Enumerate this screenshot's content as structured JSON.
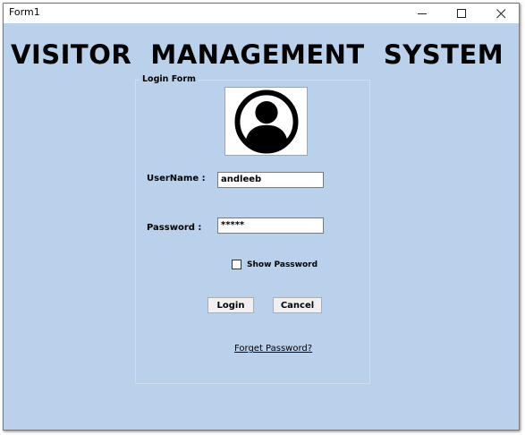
{
  "window": {
    "title": "Form1",
    "minimize_label": "—",
    "maximize_label": "☐",
    "close_label": "✕"
  },
  "app": {
    "title": "VISITOR  MANAGEMENT  SYSTEM"
  },
  "login_form": {
    "group_label": "Login Form",
    "username_label": "UserName :",
    "username_value": "andleeb",
    "password_label": "Password :",
    "password_value": "*****",
    "show_password_label": "Show Password",
    "show_password_checked": false,
    "login_button": "Login",
    "cancel_button": "Cancel",
    "forget_link": "Forget Password?"
  },
  "colors": {
    "background": "#b9d1ea",
    "titlebar": "#ffffff"
  },
  "icons": {
    "avatar": "user-avatar-icon"
  }
}
